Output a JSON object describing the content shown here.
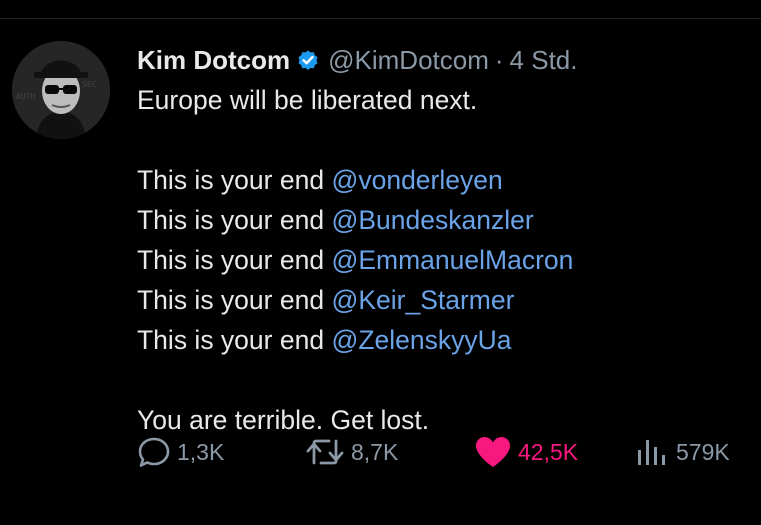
{
  "tweet": {
    "author_name": "Kim Dotcom",
    "handle": "@KimDotcom",
    "separator": "·",
    "time": "4 Std.",
    "line1": "Europe will be liberated next.",
    "prefix": "This is your end",
    "mentions": [
      "@vonderleyen",
      "@Bundeskanzler",
      "@EmmanuelMacron",
      "@Keir_Starmer",
      "@ZelenskyyUa"
    ],
    "closing": "You are terrible. Get lost."
  },
  "actions": {
    "replies": "1,3K",
    "reposts": "8,7K",
    "likes": "42,5K",
    "views": "579K"
  },
  "colors": {
    "background": "#000000",
    "text": "#e7e9ea",
    "muted": "#8b98a5",
    "mention": "#6aa3e8",
    "like": "#f91880",
    "verified": "#1d9bf0"
  }
}
